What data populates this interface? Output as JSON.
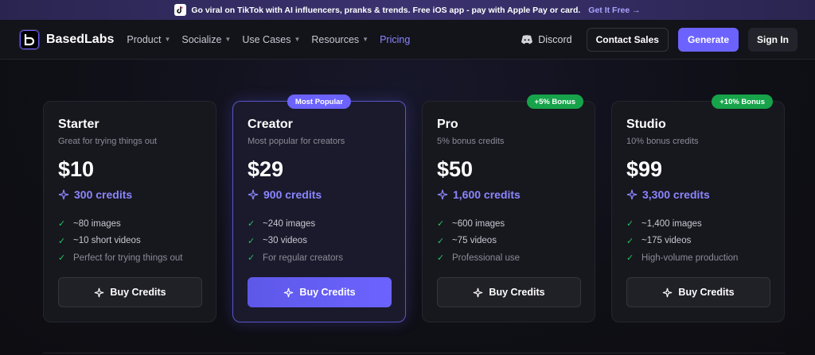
{
  "banner": {
    "text": "Go viral on TikTok with AI influencers, pranks & trends. Free iOS app - pay with Apple Pay or card.",
    "cta": "Get It Free →"
  },
  "nav": {
    "brand": "BasedLabs",
    "items": [
      {
        "label": "Product",
        "dropdown": true
      },
      {
        "label": "Socialize",
        "dropdown": true
      },
      {
        "label": "Use Cases",
        "dropdown": true
      },
      {
        "label": "Resources",
        "dropdown": true
      },
      {
        "label": "Pricing",
        "dropdown": false,
        "active": true
      }
    ],
    "discord": "Discord",
    "contact": "Contact Sales",
    "generate": "Generate",
    "signin": "Sign In"
  },
  "plans": [
    {
      "name": "Starter",
      "subtitle": "Great for trying things out",
      "price": "$10",
      "credits": "300 credits",
      "badge": "",
      "features": [
        "~80 images",
        "~10 short videos",
        "Perfect for trying things out"
      ],
      "button": "Buy Credits"
    },
    {
      "name": "Creator",
      "subtitle": "Most popular for creators",
      "price": "$29",
      "credits": "900 credits",
      "badge": "Most Popular",
      "features": [
        "~240 images",
        "~30 videos",
        "For regular creators"
      ],
      "button": "Buy Credits"
    },
    {
      "name": "Pro",
      "subtitle": "5% bonus credits",
      "price": "$50",
      "credits": "1,600 credits",
      "badge": "+5% Bonus",
      "features": [
        "~600 images",
        "~75 videos",
        "Professional use"
      ],
      "button": "Buy Credits"
    },
    {
      "name": "Studio",
      "subtitle": "10% bonus credits",
      "price": "$99",
      "credits": "3,300 credits",
      "badge": "+10% Bonus",
      "features": [
        "~1,400 images",
        "~175 videos",
        "High-volume production"
      ],
      "button": "Buy Credits"
    }
  ],
  "colors": {
    "accent": "#6c63ff",
    "accent_text": "#8b86ff",
    "bonus_green": "#16a34a",
    "check_green": "#22c55e"
  }
}
